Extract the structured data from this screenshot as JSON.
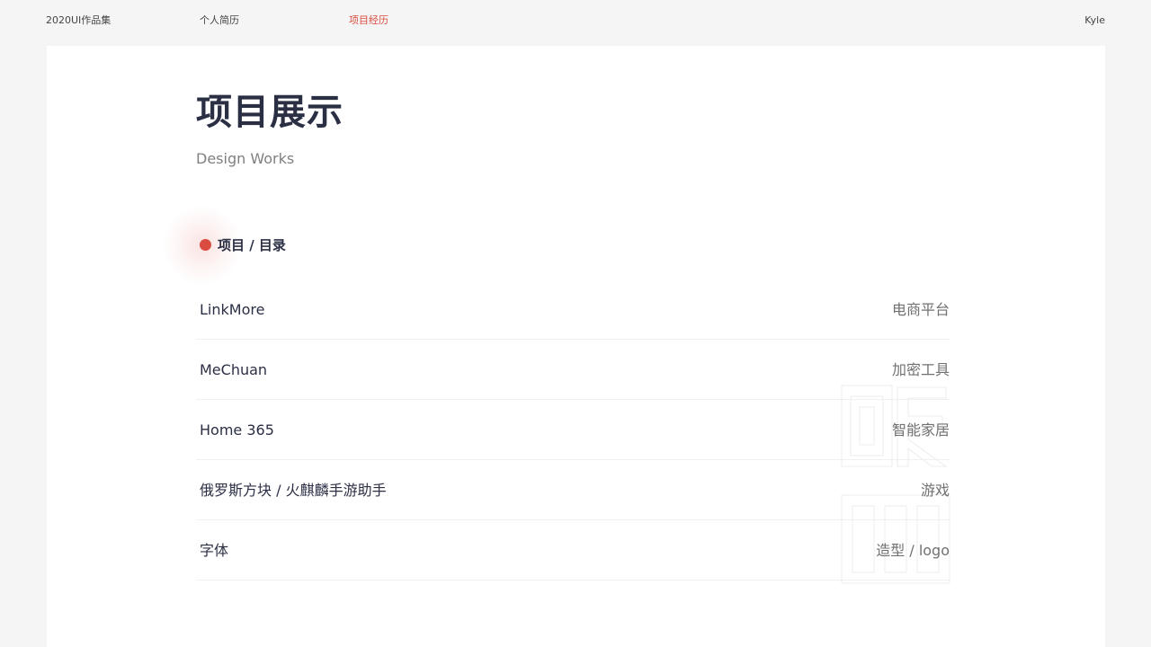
{
  "nav": {
    "brand": "2020UI作品集",
    "resume": "个人简历",
    "projects": "项目经历",
    "user": "Kyle"
  },
  "colors": {
    "accent": "#d94c3f",
    "title": "#2b2f44",
    "background": "#f5f5f5",
    "card": "#ffffff"
  },
  "page": {
    "title": "项目展示",
    "subtitle": "Design Works"
  },
  "section": {
    "title": "项目 / 目录"
  },
  "projects": [
    {
      "name": "LinkMore",
      "category": "电商平台"
    },
    {
      "name": "MeChuan",
      "category": "加密工具"
    },
    {
      "name": "Home 365",
      "category": "智能家居"
    },
    {
      "name": "俄罗斯方块 / 火麒麟手游助手",
      "category": "游戏"
    },
    {
      "name": "字体",
      "category": "造型 / logo"
    }
  ]
}
